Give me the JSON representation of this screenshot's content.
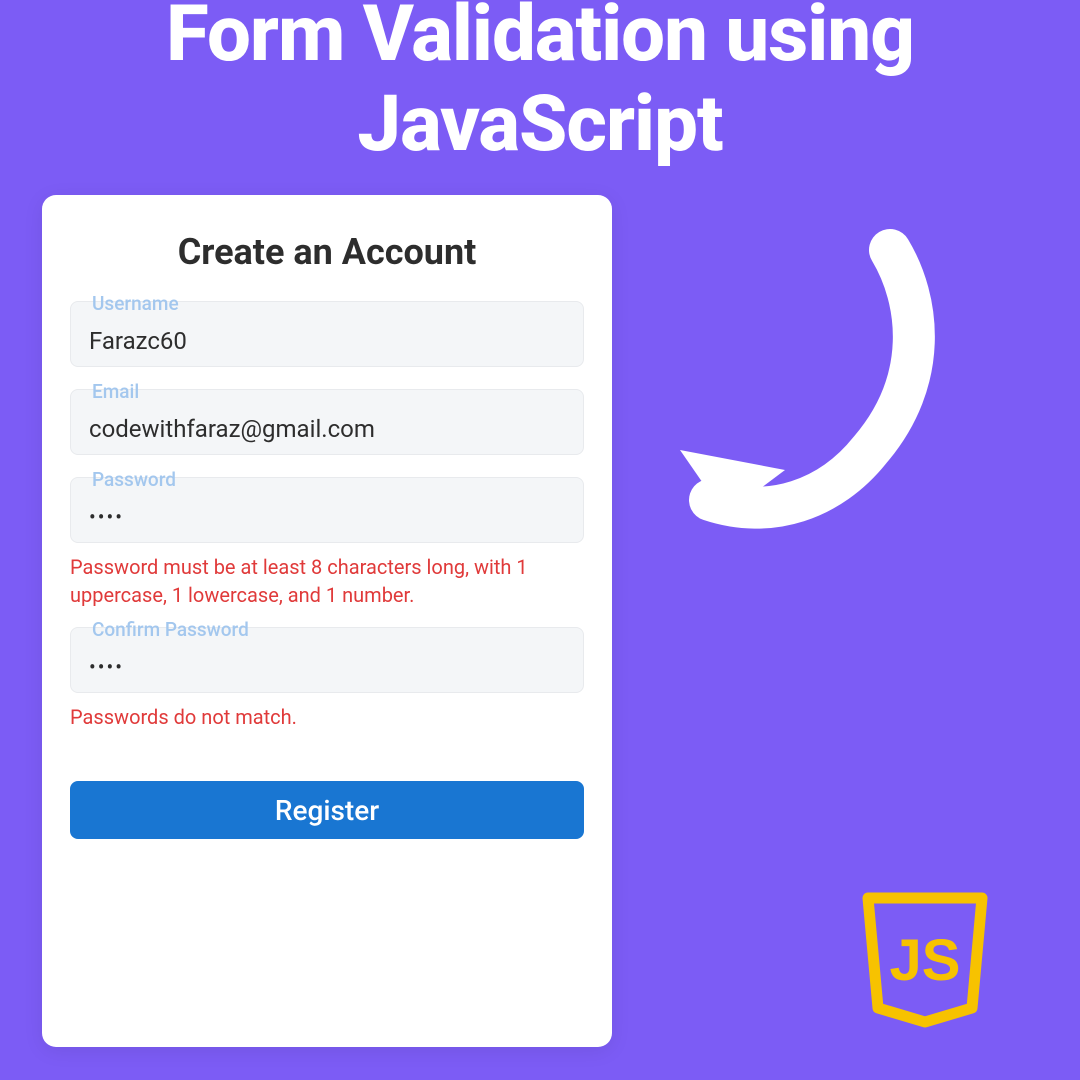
{
  "page_title": "Form Validation using JavaScript",
  "form": {
    "header": "Create an Account",
    "fields": {
      "username": {
        "label": "Username",
        "value": "Farazc60"
      },
      "email": {
        "label": "Email",
        "value": "codewithfaraz@gmail.com"
      },
      "password": {
        "label": "Password",
        "value": "••••",
        "error": "Password must be at least 8 characters long, with 1 uppercase, 1 lowercase, and 1 number."
      },
      "confirm_password": {
        "label": "Confirm Password",
        "value": "••••",
        "error": "Passwords do not match."
      }
    },
    "submit_label": "Register"
  },
  "colors": {
    "background": "#7c5cf5",
    "button": "#1976d2",
    "error": "#e03a3a",
    "label": "#a3c7ee",
    "js_logo": "#f7c200"
  }
}
